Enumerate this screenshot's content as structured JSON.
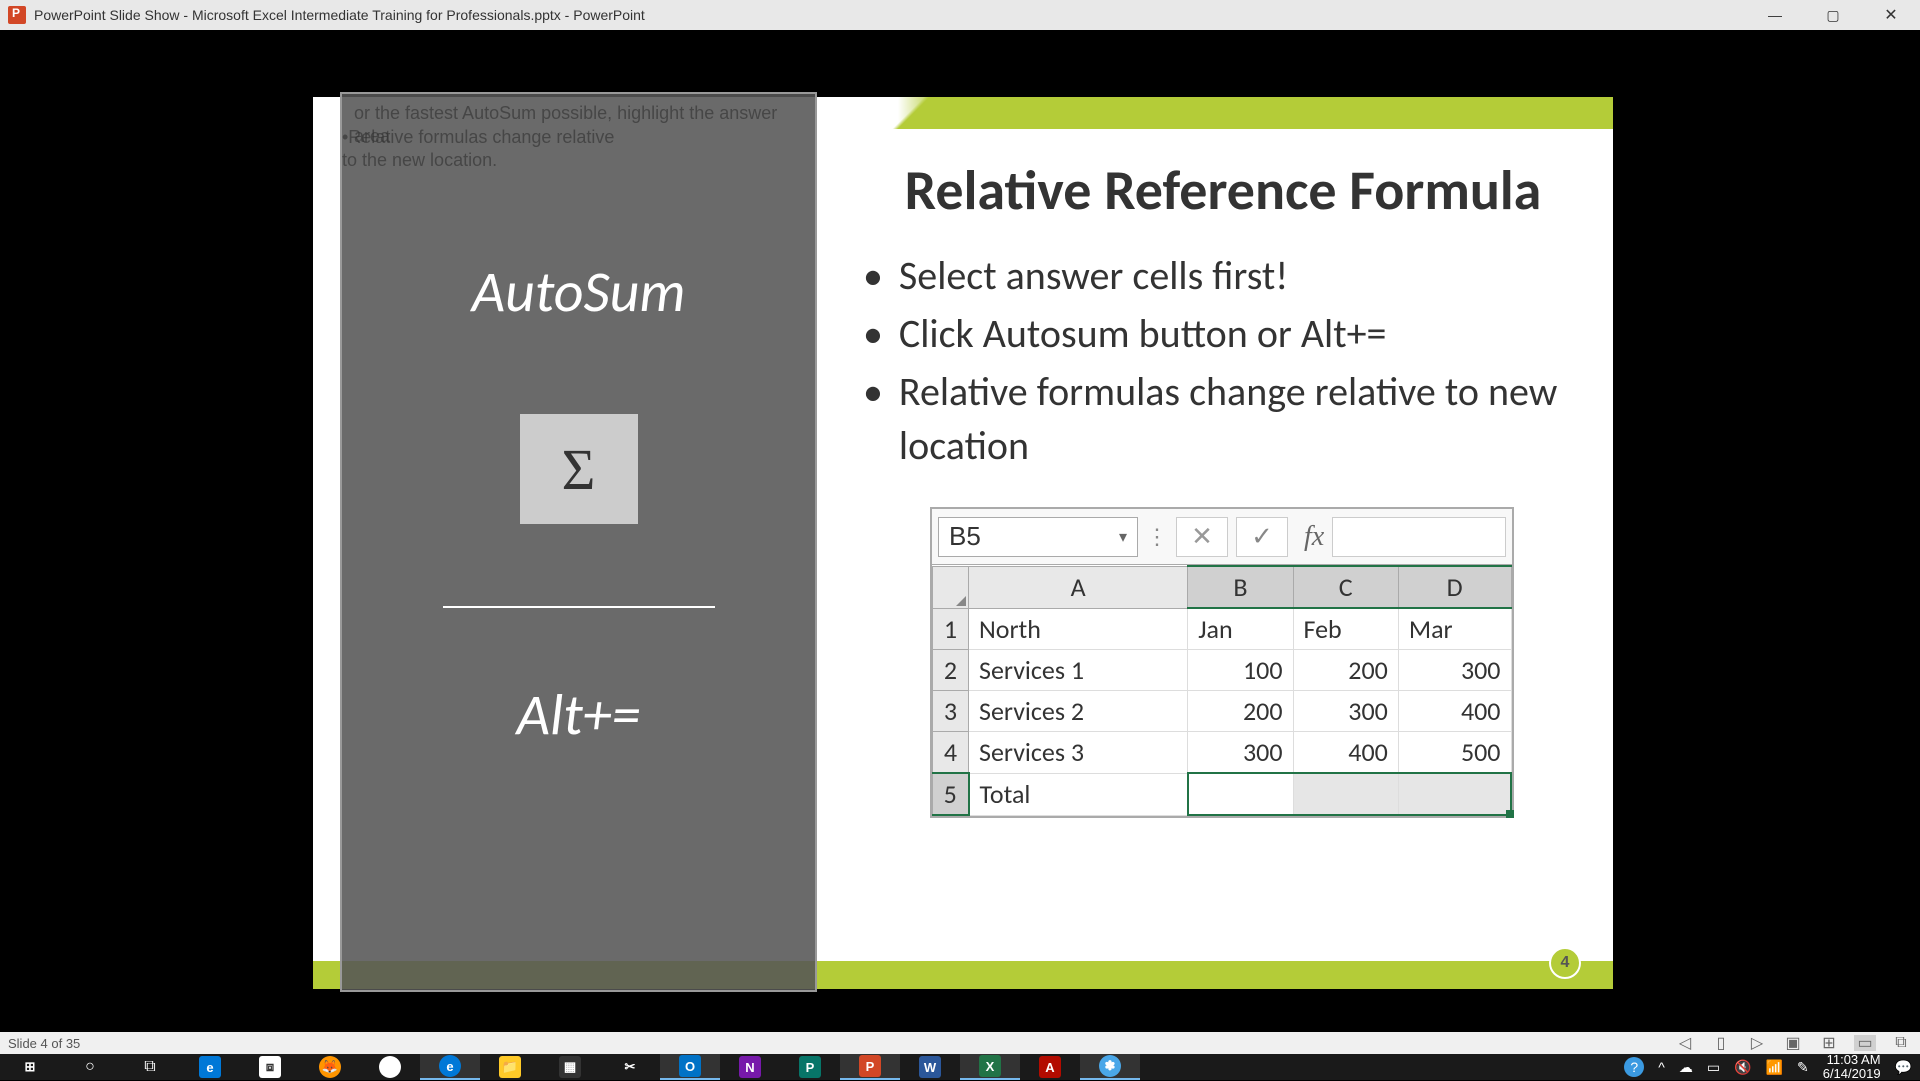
{
  "window": {
    "title": "PowerPoint Slide Show  -  Microsoft Excel Intermediate Training for Professionals.pptx - PowerPoint"
  },
  "overlay": {
    "tip_line1": "or the fastest AutoSum possible, highlight the answer area",
    "tip_line2": "•Relative formulas change relative\nto the new location.",
    "autosum_label": "AutoSum",
    "sigma_symbol": "Σ",
    "shortcut_label": "Alt+="
  },
  "slide": {
    "title": "Relative Reference Formula",
    "bullets": [
      "Select answer cells first!",
      "Click Autosum button or Alt+=",
      "Relative formulas change relative to new location"
    ],
    "page_number": "4"
  },
  "excel": {
    "active_cell": "B5",
    "fx_symbol": "fx",
    "columns": [
      "A",
      "B",
      "C",
      "D"
    ],
    "rows": [
      {
        "num": "1",
        "cells": [
          "North",
          "Jan",
          "Feb",
          "Mar"
        ]
      },
      {
        "num": "2",
        "cells": [
          "Services 1",
          "100",
          "200",
          "300"
        ]
      },
      {
        "num": "3",
        "cells": [
          "Services 2",
          "200",
          "300",
          "400"
        ]
      },
      {
        "num": "4",
        "cells": [
          "Services 3",
          "300",
          "400",
          "500"
        ]
      },
      {
        "num": "5",
        "cells": [
          "Total",
          "",
          "",
          ""
        ]
      }
    ]
  },
  "statusbar": {
    "slide_counter": "Slide 4 of 35"
  },
  "system": {
    "time": "11:03 AM",
    "date": "6/14/2019"
  }
}
